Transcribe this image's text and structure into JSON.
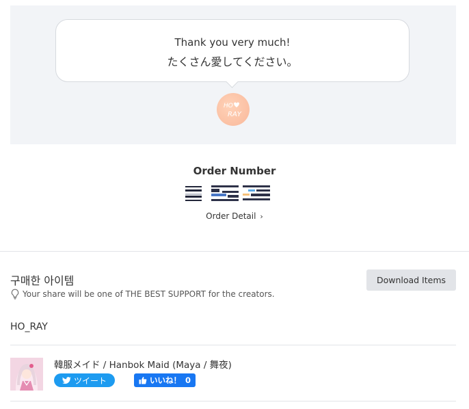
{
  "hero": {
    "message_line1": "Thank you very much!",
    "message_line2": "たくさん愛してください。",
    "avatar_text": "HO_RAY"
  },
  "order": {
    "title": "Order Number",
    "number_display": "■■■■■■",
    "detail_link": "Order Detail",
    "detail_chevron": "›"
  },
  "purchased": {
    "section_title": "구매한 아이템",
    "share_note": "Your share will be one of THE BEST SUPPORT for the creators.",
    "download_button": "Download Items",
    "creator_name": "HO_RAY",
    "items": [
      {
        "title": "韓服メイド / Hanbok Maid (Maya / 舞夜)",
        "tweet_label": "ツイート",
        "like_label": "いいね！",
        "like_count": "0"
      }
    ]
  },
  "colors": {
    "hero_bg": "#f2f4f7",
    "twitter_blue": "#1d9bf0",
    "facebook_blue": "#1877f2",
    "button_gray": "#e2e4e8"
  },
  "icons": {
    "share_note": "lightbulb-icon",
    "tweet": "twitter-bird-icon",
    "like": "thumbs-up-icon",
    "detail": "chevron-right-icon"
  }
}
